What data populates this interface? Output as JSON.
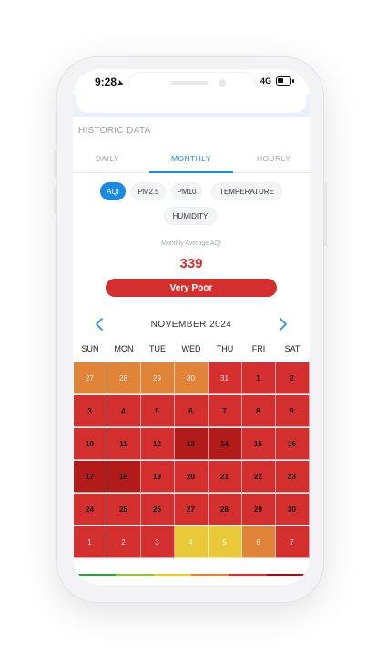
{
  "status_bar": {
    "time": "9:28",
    "network": "4G"
  },
  "historic": {
    "title": "HISTORIC DATA",
    "tabs": [
      {
        "label": "DAILY",
        "active": false
      },
      {
        "label": "MONTHLY",
        "active": true
      },
      {
        "label": "HOURLY",
        "active": false
      }
    ],
    "parameters": [
      {
        "label": "AQI",
        "active": true
      },
      {
        "label": "PM2.5",
        "active": false
      },
      {
        "label": "PM10",
        "active": false
      },
      {
        "label": "TEMPERATURE",
        "active": false
      },
      {
        "label": "HUMIDITY",
        "active": false
      }
    ],
    "average_label": "Monthly Average AQI",
    "average_value": "339",
    "status": "Very Poor",
    "status_color": "#d32f2f",
    "month": "NOVEMBER 2024",
    "weekdays": [
      "SUN",
      "MON",
      "TUE",
      "WED",
      "THU",
      "FRI",
      "SAT"
    ],
    "days": [
      {
        "day": "27",
        "in_month": false,
        "level": "poor"
      },
      {
        "day": "28",
        "in_month": false,
        "level": "poor"
      },
      {
        "day": "29",
        "in_month": false,
        "level": "poor"
      },
      {
        "day": "30",
        "in_month": false,
        "level": "poor"
      },
      {
        "day": "31",
        "in_month": false,
        "level": "very_poor"
      },
      {
        "day": "1",
        "in_month": true,
        "level": "very_poor"
      },
      {
        "day": "2",
        "in_month": true,
        "level": "very_poor"
      },
      {
        "day": "3",
        "in_month": true,
        "level": "very_poor"
      },
      {
        "day": "4",
        "in_month": true,
        "level": "very_poor"
      },
      {
        "day": "5",
        "in_month": true,
        "level": "very_poor"
      },
      {
        "day": "6",
        "in_month": true,
        "level": "very_poor"
      },
      {
        "day": "7",
        "in_month": true,
        "level": "very_poor"
      },
      {
        "day": "8",
        "in_month": true,
        "level": "very_poor"
      },
      {
        "day": "9",
        "in_month": true,
        "level": "very_poor"
      },
      {
        "day": "10",
        "in_month": true,
        "level": "very_poor"
      },
      {
        "day": "11",
        "in_month": true,
        "level": "very_poor"
      },
      {
        "day": "12",
        "in_month": true,
        "level": "very_poor"
      },
      {
        "day": "13",
        "in_month": true,
        "level": "severe"
      },
      {
        "day": "14",
        "in_month": true,
        "level": "severe"
      },
      {
        "day": "15",
        "in_month": true,
        "level": "very_poor"
      },
      {
        "day": "16",
        "in_month": true,
        "level": "very_poor"
      },
      {
        "day": "17",
        "in_month": true,
        "level": "severe"
      },
      {
        "day": "18",
        "in_month": true,
        "level": "severe"
      },
      {
        "day": "19",
        "in_month": true,
        "level": "very_poor"
      },
      {
        "day": "20",
        "in_month": true,
        "level": "very_poor"
      },
      {
        "day": "21",
        "in_month": true,
        "level": "very_poor"
      },
      {
        "day": "22",
        "in_month": true,
        "level": "very_poor"
      },
      {
        "day": "23",
        "in_month": true,
        "level": "very_poor"
      },
      {
        "day": "24",
        "in_month": true,
        "level": "very_poor"
      },
      {
        "day": "25",
        "in_month": true,
        "level": "very_poor"
      },
      {
        "day": "26",
        "in_month": true,
        "level": "very_poor"
      },
      {
        "day": "27",
        "in_month": true,
        "level": "very_poor"
      },
      {
        "day": "28",
        "in_month": true,
        "level": "very_poor"
      },
      {
        "day": "29",
        "in_month": true,
        "level": "very_poor"
      },
      {
        "day": "30",
        "in_month": true,
        "level": "very_poor"
      },
      {
        "day": "1",
        "in_month": false,
        "level": "very_poor"
      },
      {
        "day": "2",
        "in_month": false,
        "level": "very_poor"
      },
      {
        "day": "3",
        "in_month": false,
        "level": "very_poor"
      },
      {
        "day": "4",
        "in_month": false,
        "level": "moderate"
      },
      {
        "day": "5",
        "in_month": false,
        "level": "moderate"
      },
      {
        "day": "6",
        "in_month": false,
        "level": "poor"
      },
      {
        "day": "7",
        "in_month": false,
        "level": "very_poor"
      }
    ],
    "level_colors": {
      "moderate": "#e8c93a",
      "poor": "#e0843a",
      "very_poor": "#d32f2f",
      "severe": "#b31a1a"
    },
    "scale_colors": [
      "#2e9e3e",
      "#8dc63f",
      "#e8c93a",
      "#e0843a",
      "#d32f2f",
      "#9b1111"
    ]
  }
}
